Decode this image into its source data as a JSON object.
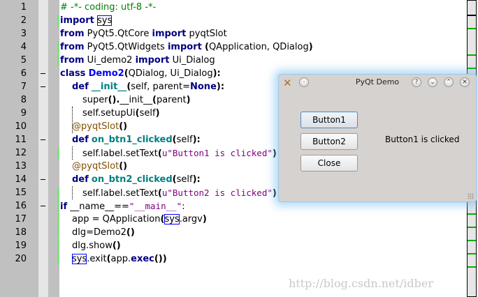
{
  "editor": {
    "lines": [
      {
        "n": "1",
        "indent": 0,
        "changed": false,
        "fold": false,
        "tokens": [
          [
            "# -*- coding: utf-8 -*-",
            "cm"
          ]
        ]
      },
      {
        "n": "2",
        "indent": 0,
        "changed": true,
        "fold": false,
        "tokens": [
          [
            "import",
            "kw"
          ],
          [
            " ",
            ""
          ],
          [
            "sys",
            "hl"
          ]
        ]
      },
      {
        "n": "3",
        "indent": 0,
        "changed": false,
        "fold": false,
        "tokens": [
          [
            "from",
            "kw"
          ],
          [
            " PyQt5.QtCore ",
            ""
          ],
          [
            "import",
            "kw"
          ],
          [
            " pyqtSlot",
            ""
          ]
        ]
      },
      {
        "n": "4",
        "indent": 0,
        "changed": true,
        "fold": false,
        "tokens": [
          [
            "from",
            "kw"
          ],
          [
            " PyQt5.QtWidgets ",
            ""
          ],
          [
            "import",
            "kw"
          ],
          [
            " ",
            ""
          ],
          [
            "(",
            "par"
          ],
          [
            "QApplication, QDialog",
            ""
          ],
          [
            ")",
            "par"
          ]
        ]
      },
      {
        "n": "5",
        "indent": 0,
        "changed": true,
        "fold": false,
        "tokens": [
          [
            "from",
            "kw"
          ],
          [
            " Ui_demo2 ",
            ""
          ],
          [
            "import",
            "kw"
          ],
          [
            " Ui_Dialog",
            ""
          ]
        ]
      },
      {
        "n": "6",
        "indent": 0,
        "changed": false,
        "fold": true,
        "tokens": [
          [
            "class",
            "kw"
          ],
          [
            " ",
            ""
          ],
          [
            "Demo2",
            "cls"
          ],
          [
            "(",
            "par"
          ],
          [
            "QDialog, Ui_Dialog",
            ""
          ],
          [
            "):",
            "par"
          ]
        ]
      },
      {
        "n": "7",
        "indent": 1,
        "changed": false,
        "fold": true,
        "tokens": [
          [
            "def",
            "kw"
          ],
          [
            " ",
            ""
          ],
          [
            "__init__",
            "fn"
          ],
          [
            "(",
            "par"
          ],
          [
            "self, parent=",
            ""
          ],
          [
            "None",
            "kw"
          ],
          [
            "):",
            "par"
          ]
        ]
      },
      {
        "n": "8",
        "indent": 2,
        "changed": false,
        "fold": false,
        "tokens": [
          [
            "super",
            ""
          ],
          [
            "().",
            "par"
          ],
          [
            "__init__",
            ""
          ],
          [
            "(",
            "par"
          ],
          [
            "parent",
            ""
          ],
          [
            ")",
            "par"
          ]
        ]
      },
      {
        "n": "9",
        "indent": 2,
        "changed": false,
        "fold": false,
        "tokens": [
          [
            "self.setupUi",
            ""
          ],
          [
            "(",
            "par"
          ],
          [
            "self",
            ""
          ],
          [
            ")",
            "par"
          ]
        ]
      },
      {
        "n": "10",
        "indent": 1,
        "changed": false,
        "fold": false,
        "tokens": [
          [
            "@pyqtSlot",
            "dec"
          ],
          [
            "()",
            "par"
          ]
        ]
      },
      {
        "n": "11",
        "indent": 1,
        "changed": false,
        "fold": true,
        "tokens": [
          [
            "def",
            "kw"
          ],
          [
            " ",
            ""
          ],
          [
            "on_btn1_clicked",
            "fn"
          ],
          [
            "(",
            "par"
          ],
          [
            "self",
            ""
          ],
          [
            "):",
            "par"
          ]
        ]
      },
      {
        "n": "12",
        "indent": 2,
        "changed": true,
        "fold": false,
        "tokens": [
          [
            "self.label.setText",
            ""
          ],
          [
            "(",
            "par"
          ],
          [
            "u\"Button1 is clicked\"",
            "str"
          ],
          [
            ")",
            "par"
          ]
        ]
      },
      {
        "n": "13",
        "indent": 1,
        "changed": false,
        "fold": false,
        "tokens": [
          [
            "@pyqtSlot",
            "dec"
          ],
          [
            "()",
            "par"
          ]
        ]
      },
      {
        "n": "14",
        "indent": 1,
        "changed": false,
        "fold": true,
        "tokens": [
          [
            "def",
            "kw"
          ],
          [
            " ",
            ""
          ],
          [
            "on_btn2_clicked",
            "fn"
          ],
          [
            "(",
            "par"
          ],
          [
            "self",
            ""
          ],
          [
            "):",
            "par"
          ]
        ]
      },
      {
        "n": "15",
        "indent": 2,
        "changed": true,
        "fold": false,
        "tokens": [
          [
            "self.label.setText",
            ""
          ],
          [
            "(",
            "par"
          ],
          [
            "u\"Button2 is clicked\"",
            "str"
          ],
          [
            ")",
            "par"
          ]
        ]
      },
      {
        "n": "16",
        "indent": 0,
        "changed": true,
        "fold": true,
        "tokens": [
          [
            "if",
            "kw"
          ],
          [
            " __name__==",
            ""
          ],
          [
            "\"__main__\"",
            "str"
          ],
          [
            ":",
            ""
          ]
        ]
      },
      {
        "n": "17",
        "indent": 1,
        "changed": true,
        "fold": false,
        "tokens": [
          [
            "app = QApplication",
            ""
          ],
          [
            "(",
            "par"
          ],
          [
            "sys",
            "hl"
          ],
          [
            ".argv",
            ""
          ],
          [
            ")",
            "par"
          ]
        ]
      },
      {
        "n": "18",
        "indent": 1,
        "changed": true,
        "fold": false,
        "tokens": [
          [
            "dlg=Demo2",
            ""
          ],
          [
            "()",
            "par"
          ]
        ]
      },
      {
        "n": "19",
        "indent": 1,
        "changed": true,
        "fold": false,
        "tokens": [
          [
            "dlg.show",
            ""
          ],
          [
            "()",
            "par"
          ]
        ]
      },
      {
        "n": "20",
        "indent": 1,
        "changed": true,
        "fold": false,
        "tokens": [
          [
            "sys",
            "hl"
          ],
          [
            ".exit",
            ""
          ],
          [
            "(",
            "par"
          ],
          [
            "app.",
            ""
          ],
          [
            "exec",
            "kw"
          ],
          [
            "())",
            "par"
          ]
        ]
      }
    ]
  },
  "dialog": {
    "title": "PyQt Demo",
    "buttons": {
      "button1": "Button1",
      "button2": "Button2",
      "close": "Close"
    },
    "label": "Button1 is clicked",
    "titlebar_buttons": {
      "help": "?",
      "minimize": "⌄",
      "maximize": "⌃",
      "close": "✕"
    }
  },
  "watermark": "http://blog.csdn.net/idber",
  "colors": {
    "keyword": "#000080",
    "function": "#008080",
    "class": "#0000ff",
    "string": "#800080",
    "decorator": "#805000",
    "comment": "#008000",
    "change_marker": "#80e080"
  }
}
